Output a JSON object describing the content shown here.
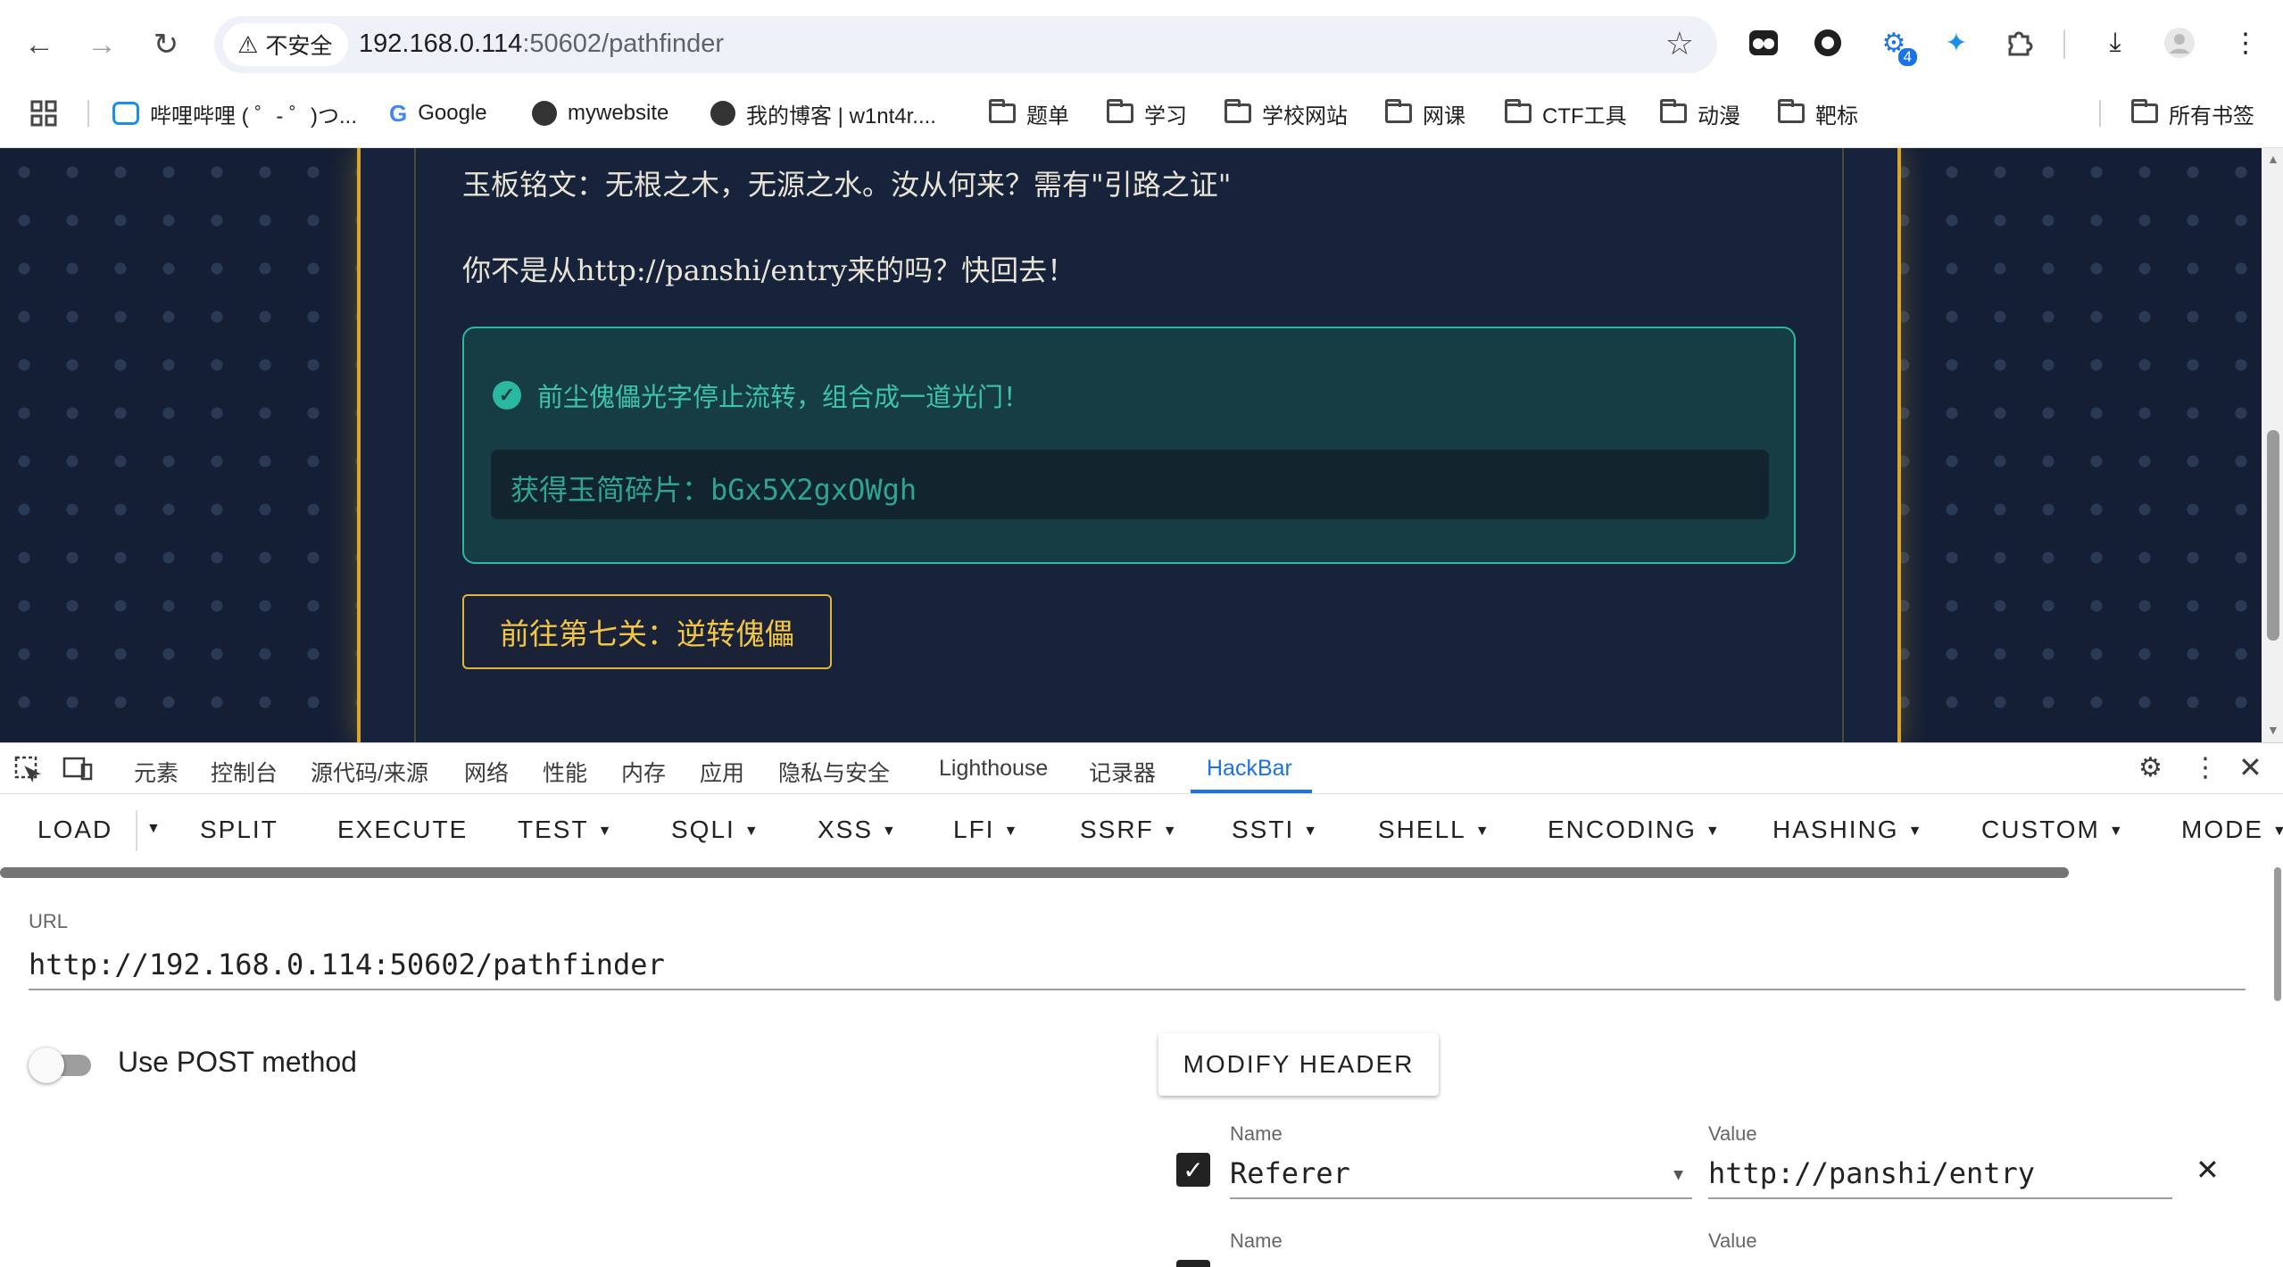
{
  "browser": {
    "security_label": "不安全",
    "url_host": "192.168.0.114",
    "url_rest": ":50602/pathfinder",
    "ext_badge": "4",
    "bookmarks": [
      {
        "label": "哔哩哔哩 ( ゜- ゜)つ...",
        "icon": "bilibili-icon"
      },
      {
        "label": "Google",
        "icon": "google-icon"
      },
      {
        "label": "mywebsite",
        "icon": "globe-icon"
      },
      {
        "label": "我的博客 | w1nt4r....",
        "icon": "globe-icon"
      },
      {
        "label": "题单",
        "icon": "folder-icon"
      },
      {
        "label": "学习",
        "icon": "folder-icon"
      },
      {
        "label": "学校网站",
        "icon": "folder-icon"
      },
      {
        "label": "网课",
        "icon": "folder-icon"
      },
      {
        "label": "CTF工具",
        "icon": "folder-icon"
      },
      {
        "label": "动漫",
        "icon": "folder-icon"
      },
      {
        "label": "靶标",
        "icon": "folder-icon"
      }
    ],
    "all_bookmarks": "所有书签"
  },
  "page": {
    "inscription": "玉板铭文：无根之木，无源之水。汝从何来？需有\"引路之证\"",
    "hint": "你不是从http://panshi/entry来的吗？快回去！",
    "success_message": "前尘傀儡光字停止流转，组合成一道光门！",
    "fragment": "获得玉简碎片：bGx5X2gxOWgh",
    "next_button": "前往第七关：逆转傀儡",
    "colors": {
      "accent_gold": "#d7a62c",
      "success_teal": "#2bb8a0",
      "background": "#141f36"
    }
  },
  "devtools": {
    "tabs": [
      "元素",
      "控制台",
      "源代码/来源",
      "网络",
      "性能",
      "内存",
      "应用",
      "隐私与安全",
      "Lighthouse",
      "记录器",
      "HackBar"
    ],
    "active_tab": "HackBar"
  },
  "hackbar": {
    "menu": [
      "LOAD",
      "SPLIT",
      "EXECUTE",
      "TEST",
      "SQLI",
      "XSS",
      "LFI",
      "SSRF",
      "SSTI",
      "SHELL",
      "ENCODING",
      "HASHING",
      "CUSTOM",
      "MODE"
    ],
    "url_label": "URL",
    "url_value": "http://192.168.0.114:50602/pathfinder",
    "post_label": "Use POST method",
    "post_enabled": false,
    "modify_header_label": "MODIFY HEADER",
    "headers": [
      {
        "name_label": "Name",
        "name": "Referer",
        "value_label": "Value",
        "value": "http://panshi/entry",
        "enabled": true
      },
      {
        "name_label": "Name",
        "name": "",
        "value_label": "Value",
        "value": "",
        "enabled": true
      }
    ]
  }
}
